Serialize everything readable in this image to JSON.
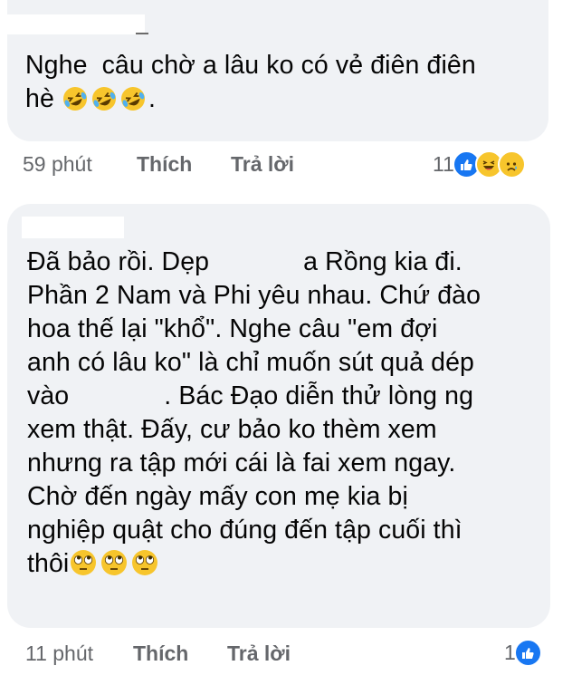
{
  "comments": [
    {
      "author": "",
      "lines": [
        "Nghe  câu chờ a lâu ko có vẻ điên điên",
        "hè"
      ],
      "trailing_emoji": [
        "rolling-on-floor-laughing",
        "rolling-on-floor-laughing",
        "rolling-on-floor-laughing"
      ],
      "trailing_text": ".",
      "time": "59 phút",
      "like_label": "Thích",
      "reply_label": "Trả lời",
      "reaction_count": "11",
      "reactions": [
        "like",
        "haha",
        "sad"
      ]
    },
    {
      "author": "",
      "lines": [
        "Đã bảo rồi. Dẹp ",
        "Phần 2 Nam và Phi yêu nhau. Chứ đào",
        "hoa thế lại \"khổ\". Nghe câu \"em đợi",
        "anh có lâu ko\" là chỉ muốn sút quả dép",
        "vào ",
        "xem thật. Đấy, cư bảo ko thèm xem",
        "nhưng ra tập mới cái là fai xem ngay.",
        "Chờ đến ngày mấy con mẹ kia bị",
        "nghiệp quật cho đúng đến tập cuối thì",
        "thôi"
      ],
      "line1_tail": "a Rồng kia đi.",
      "line5_tail": ". Bác Đạo diễn thử lòng ng",
      "trailing_emoji": [
        "face-with-rolling-eyes",
        "face-with-rolling-eyes",
        "face-with-rolling-eyes"
      ],
      "time": "11 phút",
      "like_label": "Thích",
      "reply_label": "Trả lời",
      "reaction_count": "1",
      "reactions": [
        "like"
      ]
    }
  ],
  "colors": {
    "bubble": "#f0f2f5",
    "meta_text": "#65676b",
    "like_blue": "#1877f2",
    "emoji_yellow": "#f7c52c"
  }
}
